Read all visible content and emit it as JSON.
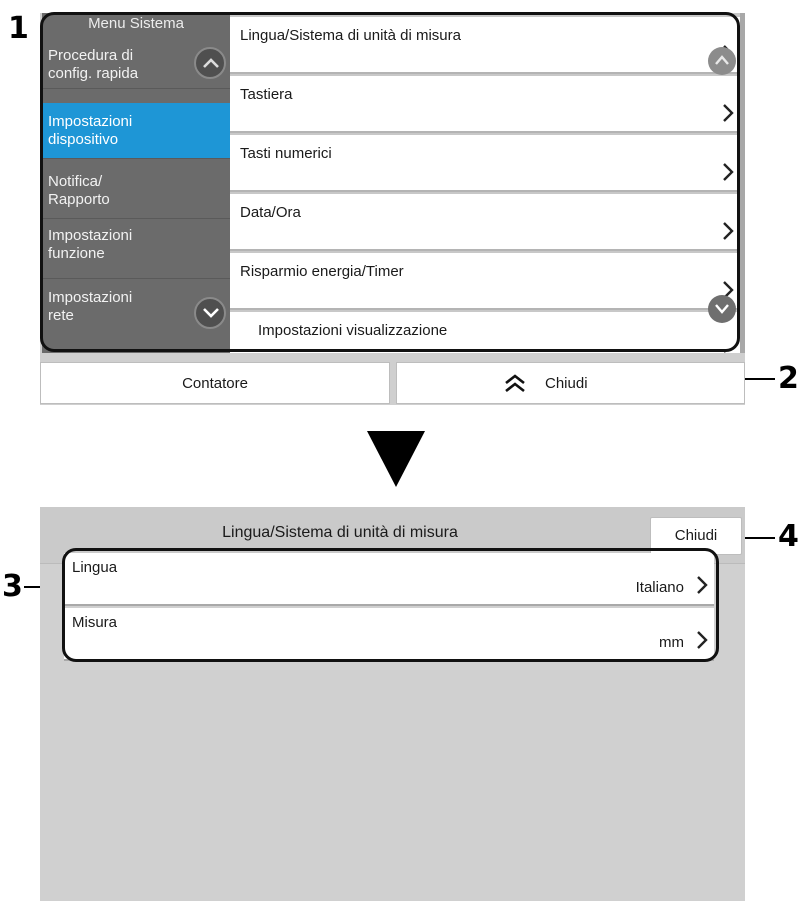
{
  "callouts": {
    "c1": "1",
    "c2": "2",
    "c3": "3",
    "c4": "4"
  },
  "screen1": {
    "sidebar": {
      "title": "Menu Sistema",
      "items": [
        {
          "label": "Procedura di config. rapida"
        },
        {
          "label": "Impostazioni dispositivo",
          "active": true
        },
        {
          "label": "Notifica/ Rapporto"
        },
        {
          "label": "Impostazioni funzione"
        },
        {
          "label": "Impostazioni rete"
        }
      ]
    },
    "menu": [
      {
        "label": "Lingua/Sistema di unità di misura"
      },
      {
        "label": "Tastiera"
      },
      {
        "label": "Tasti numerici"
      },
      {
        "label": "Data/Ora"
      },
      {
        "label": "Risparmio energia/Timer"
      },
      {
        "label": "Impostazioni visualizzazione"
      }
    ],
    "bottom": {
      "counter_label": "Contatore",
      "close_label": "Chiudi"
    }
  },
  "screen2": {
    "title": "Lingua/Sistema di unità di misura",
    "close_label": "Chiudi",
    "rows": [
      {
        "label": "Lingua",
        "value": "Italiano"
      },
      {
        "label": "Misura",
        "value": "mm"
      }
    ]
  },
  "colors": {
    "active": "#1e96d6",
    "sidebar": "#6b6b6b",
    "screen_bg": "#d0d0d0"
  },
  "icons": {
    "next": "chevron-right-icon",
    "up": "chevron-up-icon",
    "down": "chevron-down-icon",
    "close": "double-chevron-up-icon",
    "transition": "down-triangle-icon"
  }
}
